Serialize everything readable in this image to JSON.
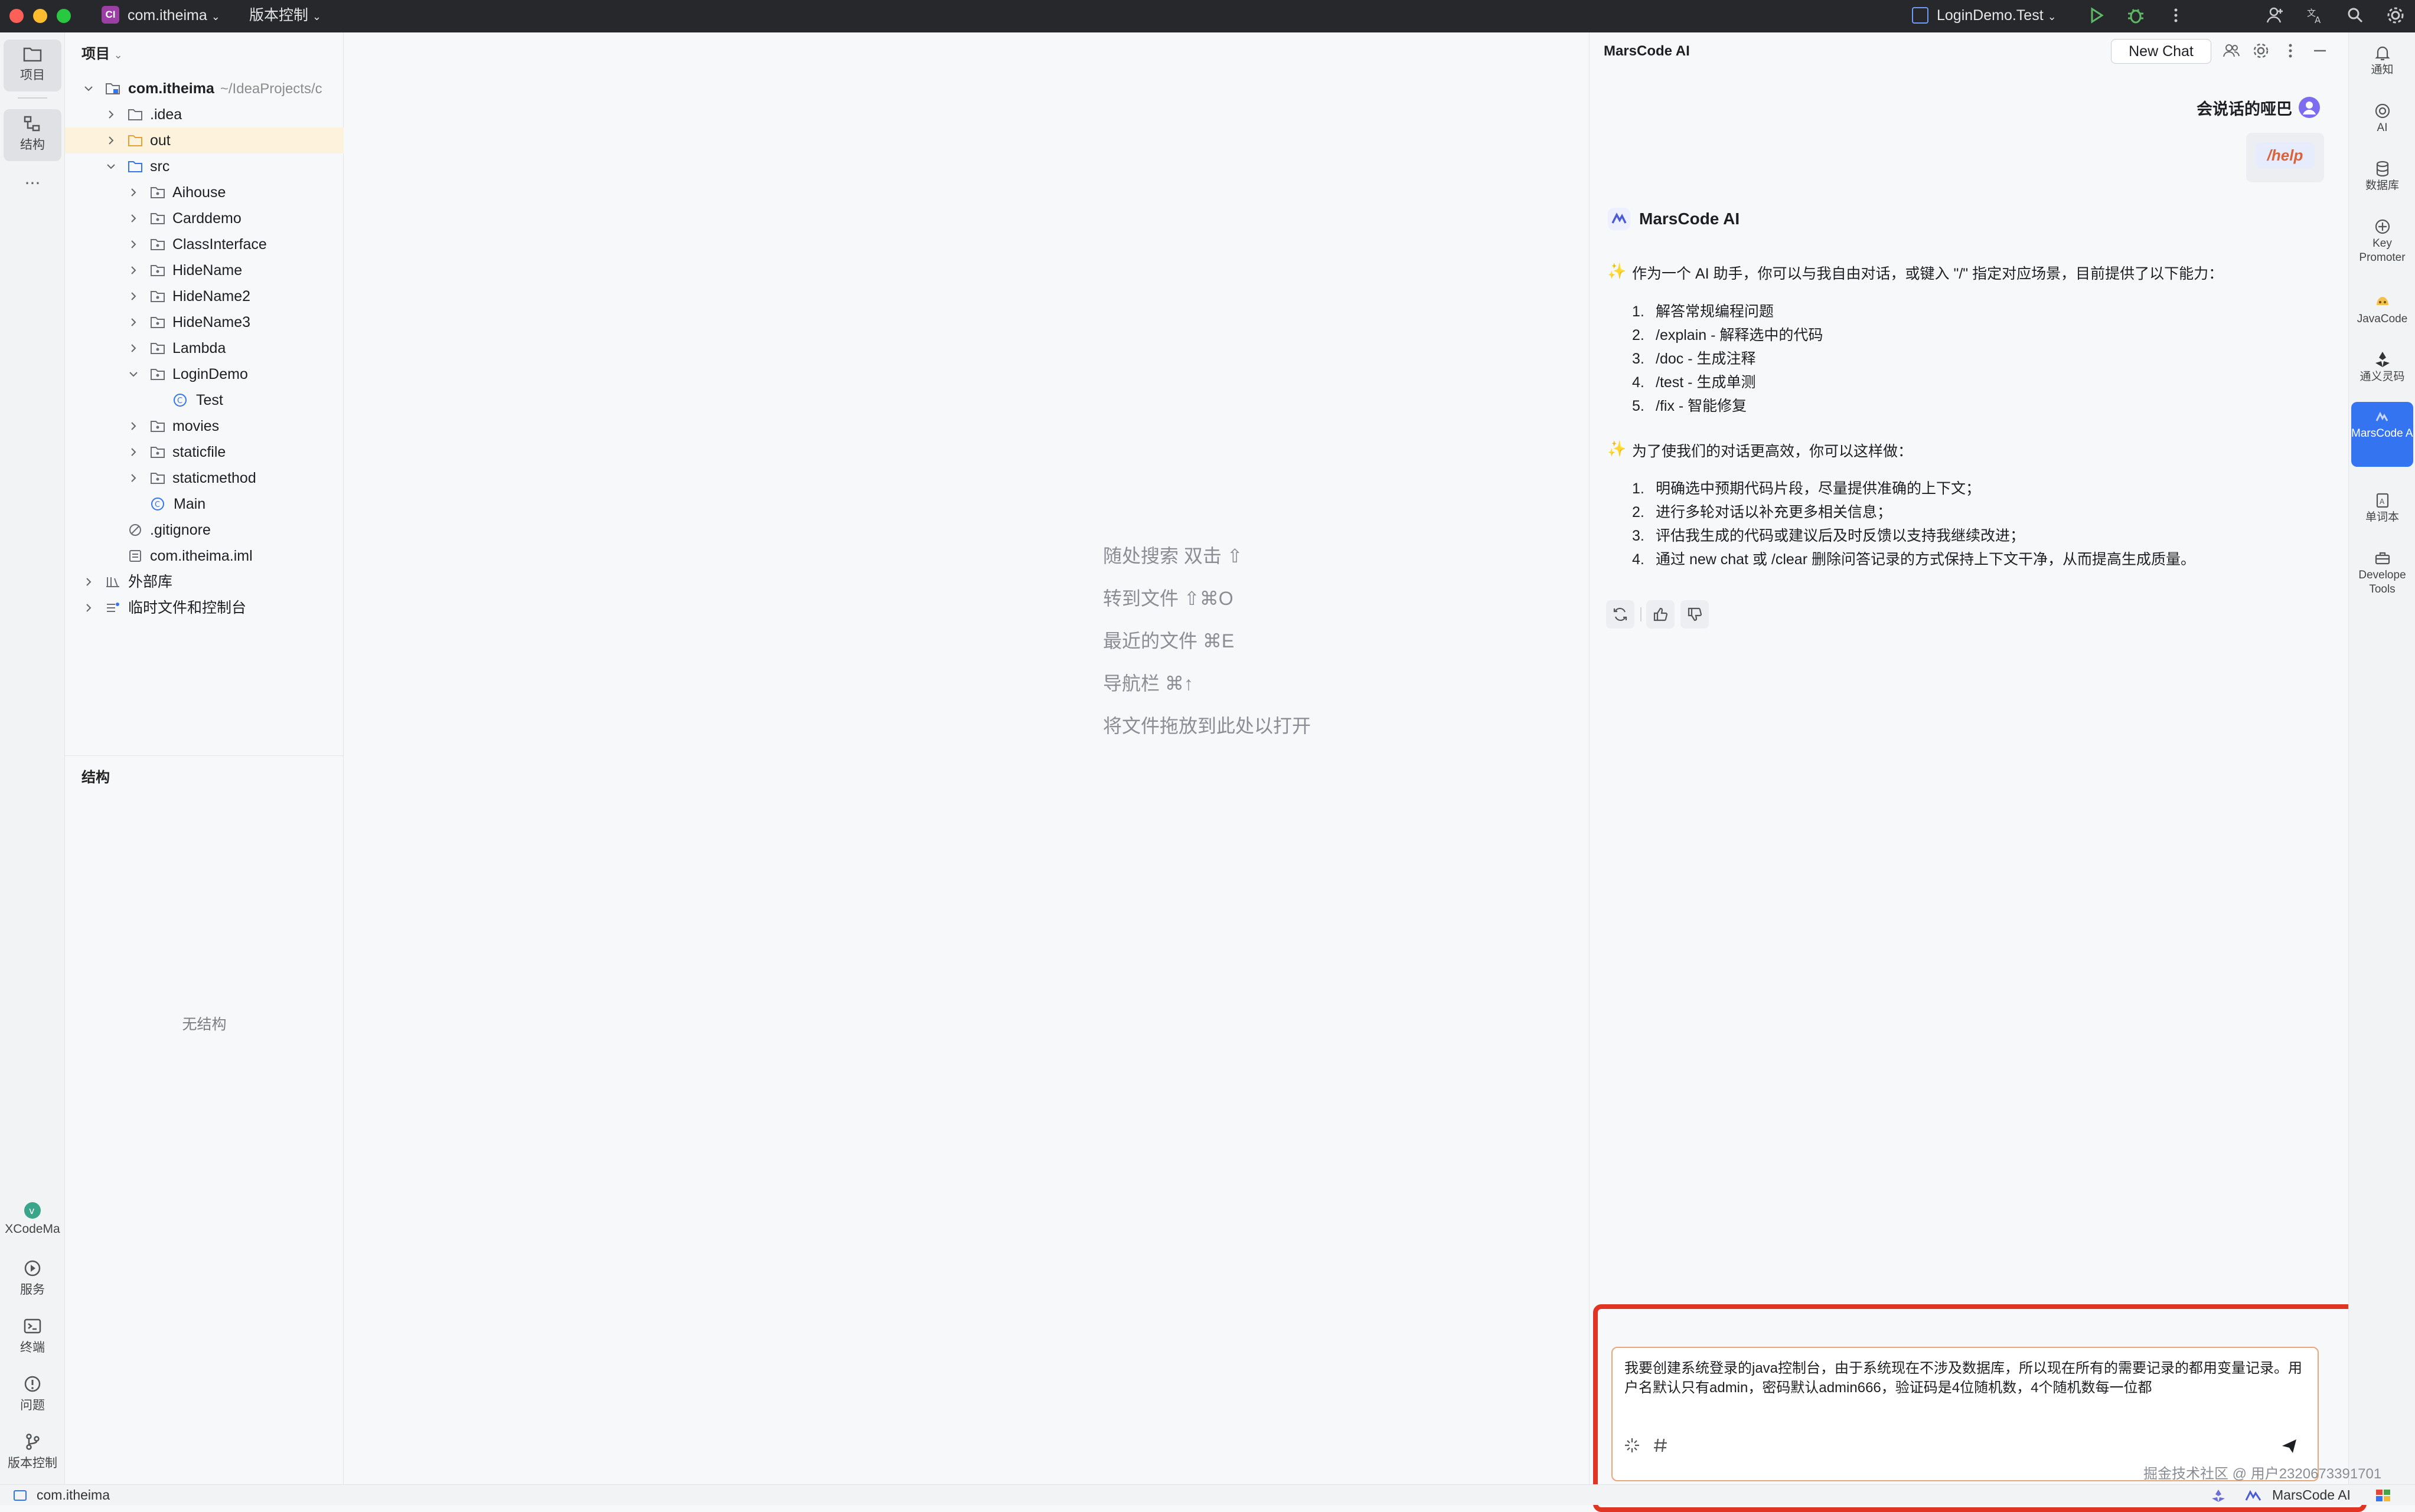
{
  "titlebar": {
    "project_badge": "CI",
    "project_name": "com.itheima",
    "vcs_menu": "版本控制",
    "run_config": "LoginDemo.Test"
  },
  "left_strip": {
    "items": [
      {
        "label": "项目",
        "icon": "folder-icon"
      },
      {
        "label": "结构",
        "icon": "structure-icon"
      },
      {
        "label": "...",
        "icon": "more-icon"
      },
      {
        "label": "XCodeMa",
        "icon": "xcodemap-icon"
      },
      {
        "label": "服务",
        "icon": "services-icon"
      },
      {
        "label": "终端",
        "icon": "terminal-icon"
      },
      {
        "label": "问题",
        "icon": "problems-icon"
      },
      {
        "label": "版本控制",
        "icon": "git-branch-icon"
      }
    ]
  },
  "project_panel": {
    "title": "项目",
    "root_name": "com.itheima",
    "root_path": "~/IdeaProjects/c",
    "tree": [
      {
        "label": ".idea",
        "type": "folder"
      },
      {
        "label": "out",
        "type": "folder-orange"
      },
      {
        "label": "src",
        "type": "folder-src"
      },
      {
        "label": "Aihouse",
        "type": "package"
      },
      {
        "label": "Carddemo",
        "type": "package"
      },
      {
        "label": "ClassInterface",
        "type": "package"
      },
      {
        "label": "HideName",
        "type": "package"
      },
      {
        "label": "HideName2",
        "type": "package"
      },
      {
        "label": "HideName3",
        "type": "package"
      },
      {
        "label": "Lambda",
        "type": "package"
      },
      {
        "label": "LoginDemo",
        "type": "package"
      },
      {
        "label": "Test",
        "type": "class"
      },
      {
        "label": "movies",
        "type": "package"
      },
      {
        "label": "staticfile",
        "type": "package"
      },
      {
        "label": "staticmethod",
        "type": "package"
      },
      {
        "label": "Main",
        "type": "class"
      },
      {
        "label": ".gitignore",
        "type": "ignore"
      },
      {
        "label": "com.itheima.iml",
        "type": "iml"
      },
      {
        "label": "外部库",
        "type": "library"
      },
      {
        "label": "临时文件和控制台",
        "type": "scratch"
      }
    ]
  },
  "structure_panel": {
    "title": "结构",
    "empty_text": "无结构"
  },
  "editor": {
    "hints": [
      "随处搜索 双击 ⇧",
      "转到文件 ⇧⌘O",
      "最近的文件 ⌘E",
      "导航栏 ⌘↑",
      "将文件拖放到此处以打开"
    ]
  },
  "ai_panel": {
    "title": "MarsCode AI",
    "new_chat": "New Chat",
    "user_name": "会说话的哑巴",
    "user_command": "/help",
    "bot_name": "MarsCode AI",
    "intro": "作为一个 AI 助手，你可以与我自由对话，或键入 \"/\" 指定对应场景，目前提供了以下能力：",
    "capabilities": [
      "解答常规编程问题",
      "/explain - 解释选中的代码",
      "/doc - 生成注释",
      "/test - 生成单测",
      "/fix - 智能修复"
    ],
    "tips_intro": "为了使我们的对话更高效，你可以这样做：",
    "tips": [
      "明确选中预期代码片段，尽量提供准确的上下文；",
      "进行多轮对话以补充更多相关信息；",
      "评估我生成的代码或建议后及时反馈以支持我继续改进；",
      "通过 new chat 或 /clear 删除问答记录的方式保持上下文干净，从而提高生成质量。"
    ],
    "input_text": "我要创建系统登录的java控制台，由于系统现在不涉及数据库，所以现在所有的需要记录的都用变量记录。用户名默认只有admin，密码默认admin666，验证码是4位随机数，4个随机数每一位都",
    "highlight_color": "#e03424",
    "accent_color": "#3574f0"
  },
  "right_strip": {
    "items": [
      {
        "label": "通知",
        "icon": "bell-icon"
      },
      {
        "label": "AI",
        "icon": "ai-icon"
      },
      {
        "label": "数据库",
        "icon": "database-icon"
      },
      {
        "label": "Key Promoter",
        "icon": "key-promoter-icon"
      },
      {
        "label": "JavaCode",
        "icon": "javacode-icon"
      },
      {
        "label": "通义灵码",
        "icon": "tongyi-icon"
      },
      {
        "label": "MarsCode AI",
        "icon": "marscode-icon"
      },
      {
        "label": "单词本",
        "icon": "wordbook-icon"
      },
      {
        "label": "Develope Tools",
        "icon": "devtools-icon"
      }
    ]
  },
  "statusbar": {
    "project": "com.itheima",
    "plugin": "MarsCode AI"
  },
  "watermark": "掘金技术社区 @ 用户2320673391701"
}
